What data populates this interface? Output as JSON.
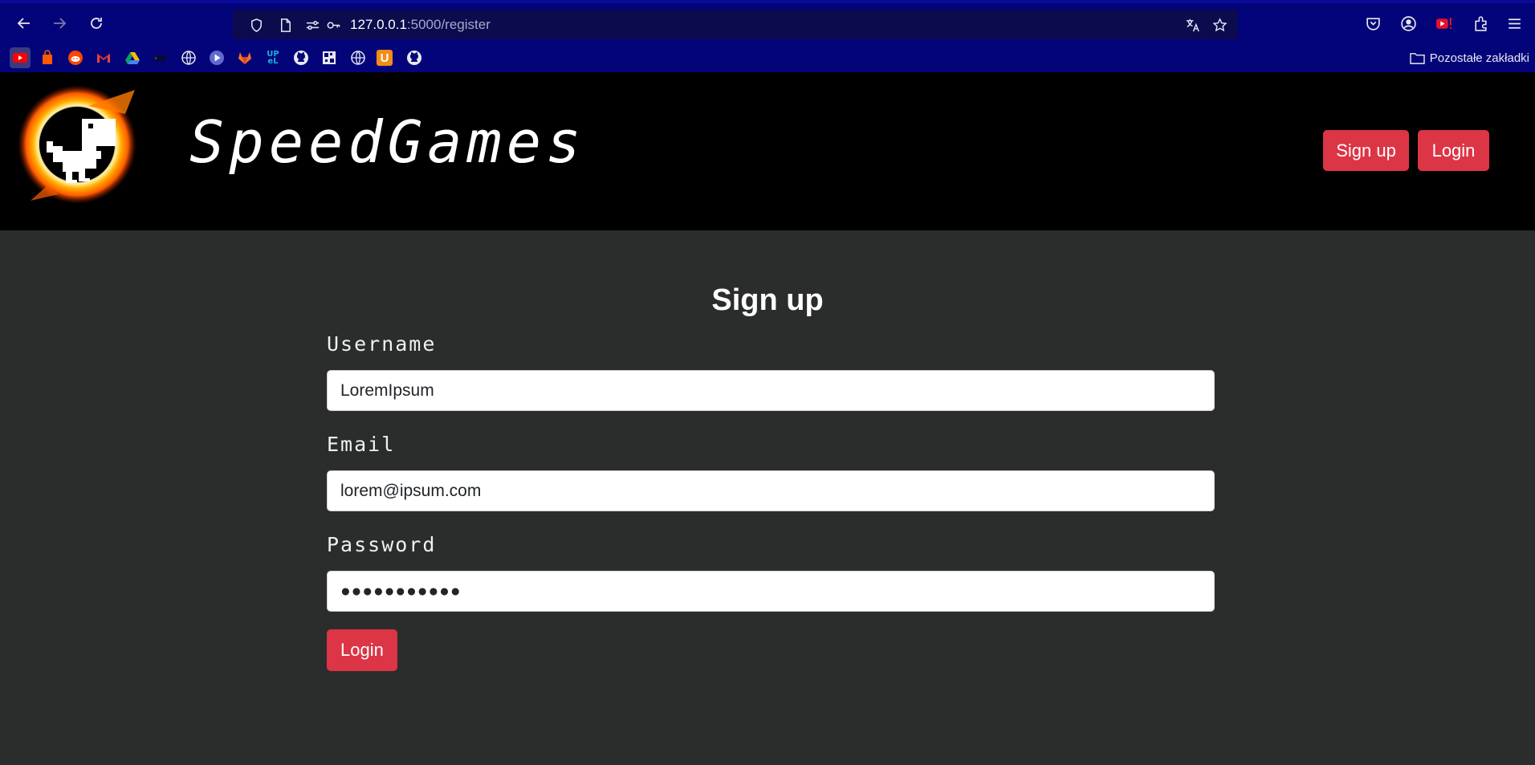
{
  "browser": {
    "url_host": "127.0.0.1",
    "url_path": ":5000/register",
    "bookmarks_folder_label": "Pozostałe zakładki",
    "bookmarks": [
      "youtube-icon",
      "shopping-icon",
      "reddit-icon",
      "gmail-icon",
      "google-drive-icon",
      "terminal-icon",
      "globe-icon",
      "play-icon",
      "gitlab-icon",
      "upel-icon",
      "github-icon",
      "puzzle-icon",
      "globe-icon",
      "u-app-icon",
      "github-icon"
    ],
    "upel_text": "UP eL",
    "u_app_text": "U"
  },
  "header": {
    "brand": "SpeedGames",
    "signup_label": "Sign up",
    "login_label": "Login"
  },
  "form": {
    "title": "Sign up",
    "username_label": "Username",
    "username_value": "LoremIpsum",
    "email_label": "Email",
    "email_value": "lorem@ipsum.com",
    "password_label": "Password",
    "password_value": "●●●●●●●●●●●",
    "submit_label": "Login"
  },
  "colors": {
    "accent": "#dc3545",
    "chrome_bg": "#04047a",
    "page_bg": "#2b2c2c",
    "header_bg": "#000000"
  }
}
